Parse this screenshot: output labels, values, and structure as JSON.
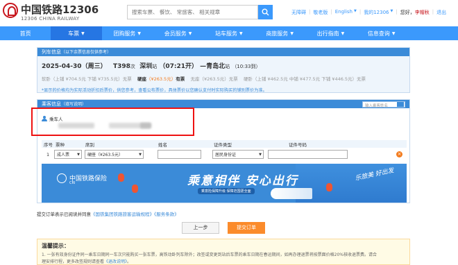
{
  "header": {
    "logo_cn": "中国铁路12306",
    "logo_en": "12306 CHINA RAILWAY",
    "search_placeholder": "搜索车票、 餐饮、 常旅客、 相关规章",
    "links": [
      "无障碍",
      "敬老版",
      "English",
      "我的12306"
    ],
    "greeting": "您好，",
    "user": "李帽秋",
    "logout": "退出"
  },
  "nav": {
    "items": [
      "首页",
      "车票",
      "团购服务",
      "会员服务",
      "站车服务",
      "商旅服务",
      "出行指南",
      "信息查询"
    ],
    "active_index": 1
  },
  "train": {
    "panel_title": "列车信息",
    "panel_sub": "（以下余票信息仅供参考）",
    "date": "2025-04-30（周三）",
    "train_no": "T398",
    "train_suffix": "次",
    "from": "深圳",
    "from_suffix": "站",
    "depart": "（07:21开）",
    "to": "—青岛北",
    "to_suffix": "站",
    "arrive": "（10:33到）",
    "seats": [
      {
        "name": "软卧",
        "detail": "（上铺 ¥704.5元 下铺 ¥735.5元）",
        "status": "无票",
        "highlight": false
      },
      {
        "name": "硬座",
        "detail": "（¥263.5元）",
        "status": "有票",
        "highlight": true
      },
      {
        "name": "无座",
        "detail": "（¥263.5元）",
        "status": "无票",
        "highlight": false
      },
      {
        "name": "硬卧",
        "detail": "（上铺 ¥462.5元 中铺 ¥477.5元 下铺 ¥446.5元）",
        "status": "无票",
        "highlight": false
      }
    ],
    "note": "*显示的价格均为实际活动折扣后票价，供您参考，查看公布票价，具体票价以您确认支付时实际购买的铺别票价为准。"
  },
  "passenger": {
    "panel_title": "乘客信息",
    "panel_sub": "（填写说明）",
    "search_placeholder": "输入乘客姓名",
    "label": "乘车人",
    "table_headers": [
      "序号",
      "票种",
      "席别",
      "姓名",
      "证件类型",
      "证件号码"
    ],
    "row": {
      "index": "1",
      "ticket_type": "成人票",
      "seat_class": "硬座（¥263.5元）",
      "id_type": "居民身份证"
    }
  },
  "banner": {
    "logo_cn": "中国铁路保险",
    "logo_en": "CRI",
    "slogan": "乘意相伴 安心出行",
    "sub": "乘意险保障升级 保障范围更全面",
    "calligraphy": "乐旅美 好出发"
  },
  "agree": {
    "prefix": "提交订单表示已阅读并同意",
    "link1": "《国铁集团铁路旅客运输规程》",
    "link2": "《服务条款》"
  },
  "buttons": {
    "prev": "上一步",
    "submit": "提交订单"
  },
  "tips": {
    "title": "温馨提示：",
    "line1": "1. 一张有效身份证件同一乘车日期同一车次只能购买一张车票，高铁动卧列车除外；改签或变更到站后车票的乘车日期在春运期间，如再办理退票将按票面价格20%核收退票费。请合",
    "line2": "理安排行程，更多改签规则请查看",
    "line2_link": "《退改说明》",
    "line2_end": "。"
  },
  "colors": {
    "brand_blue": "#3b99fc",
    "panel_blue": "#3b8bd8",
    "brand_red": "#c8161d",
    "orange": "#fb8b2b",
    "highlight_box": "#ee1111"
  }
}
